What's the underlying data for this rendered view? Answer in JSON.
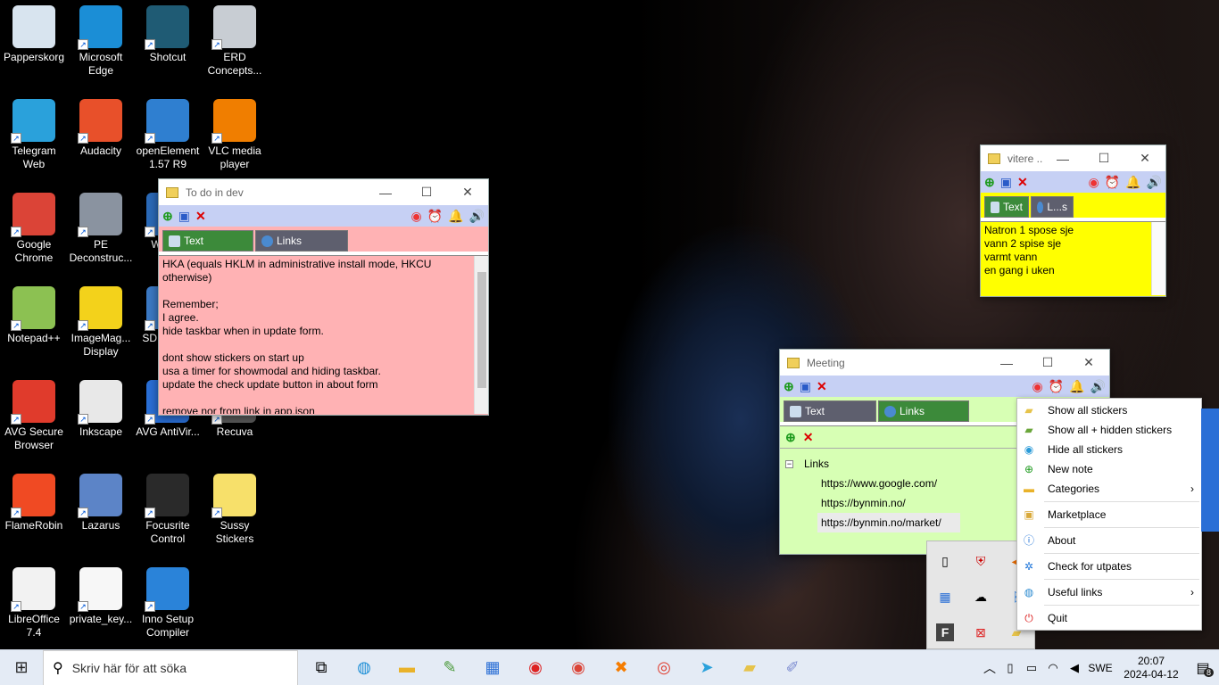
{
  "desktop_icons": [
    {
      "label": "Papperskorg",
      "icon": "recycle-bin-icon",
      "color": "#d8e4ef"
    },
    {
      "label": "Microsoft Edge",
      "icon": "edge-icon",
      "color": "#1b8ed6"
    },
    {
      "label": "Shotcut",
      "icon": "shotcut-icon",
      "color": "#1f5b74"
    },
    {
      "label": "ERD Concepts...",
      "icon": "erd-concepts-icon",
      "color": "#c8cdd3"
    },
    {
      "label": "Telegram Web",
      "icon": "telegram-icon",
      "color": "#2aa1db"
    },
    {
      "label": "Audacity",
      "icon": "audacity-icon",
      "color": "#e8502a"
    },
    {
      "label": "openElement 1.57 R9",
      "icon": "openelement-icon",
      "color": "#2f7fd0"
    },
    {
      "label": "VLC media player",
      "icon": "vlc-icon",
      "color": "#f07e00"
    },
    {
      "label": "Google Chrome",
      "icon": "chrome-icon",
      "color": "#db4437"
    },
    {
      "label": "PE Deconstruc...",
      "icon": "pe-deconstructor-icon",
      "color": "#8a93a0"
    },
    {
      "label": "Win3...",
      "icon": "win-icon",
      "color": "#2b6ab8"
    },
    {
      "label": "Notepad++",
      "icon": "notepad-plus-icon",
      "color": "#8cc152"
    },
    {
      "label": "ImageMag... Display",
      "icon": "imagemagick-icon",
      "color": "#f3d21b"
    },
    {
      "label": "SD... For...",
      "icon": "sd-icon",
      "color": "#3b79c4"
    },
    {
      "label": "AVG Secure Browser",
      "icon": "avg-browser-icon",
      "color": "#e03b2c"
    },
    {
      "label": "Inkscape",
      "icon": "inkscape-icon",
      "color": "#e8e8e8"
    },
    {
      "label": "AVG AntiVir...",
      "icon": "avg-antivirus-icon",
      "color": "#2a6fd6"
    },
    {
      "label": "Recuva",
      "icon": "recuva-icon",
      "color": "#5a5a5a"
    },
    {
      "label": "FlameRobin",
      "icon": "flamerobin-icon",
      "color": "#f04a23"
    },
    {
      "label": "Lazarus",
      "icon": "lazarus-icon",
      "color": "#5c84c7"
    },
    {
      "label": "Focusrite Control",
      "icon": "focusrite-icon",
      "color": "#2a2a2a"
    },
    {
      "label": "Sussy Stickers",
      "icon": "sussy-stickers-icon",
      "color": "#f7e06a"
    },
    {
      "label": "LibreOffice 7.4",
      "icon": "libreoffice-icon",
      "color": "#f2f2f2"
    },
    {
      "label": "private_key...",
      "icon": "file-icon",
      "color": "#f7f7f7"
    },
    {
      "label": "Inno Setup Compiler",
      "icon": "inno-setup-icon",
      "color": "#2a83d9"
    }
  ],
  "todo_window": {
    "title": "To do in dev",
    "tabs": [
      "Text",
      "Links"
    ],
    "bg": "#ffb2b4",
    "text": "HKA (equals HKLM in administrative install mode, HKCU otherwise)\n\nRemember;\nI agree.\nhide taskbar when in update form.\n\ndont show stickers on start up\nusa a timer for showmodal and hiding taskbar.\nupdate the check update button in about form\n\nremove nor from link in app.json"
  },
  "vitere_window": {
    "title": "vitere ...",
    "tabs": [
      "Text",
      "L...s"
    ],
    "bg": "#ffff00",
    "text": "Natron 1 spose sje\nvann 2 spise sje\nvarmt vann\nen gang i uken"
  },
  "meeting_window": {
    "title": "Meeting",
    "tabs": [
      "Text",
      "Links"
    ],
    "bg": "#d7ffb4",
    "tree_root": "Links",
    "links": [
      "https://www.google.com/",
      "https://bynmin.no/",
      "https://bynmin.no/market/"
    ]
  },
  "tray_menu": {
    "items": [
      {
        "label": "Show all stickers",
        "icon": "sticker-icon"
      },
      {
        "label": "Show all + hidden stickers",
        "icon": "sticker-plus-icon"
      },
      {
        "label": "Hide all stickers",
        "icon": "eye-icon"
      },
      {
        "label": "New note",
        "icon": "plus-icon"
      },
      {
        "label": "Categories",
        "icon": "folder-icon",
        "submenu": true
      },
      {
        "label": "Marketplace",
        "icon": "package-icon"
      },
      {
        "label": "About",
        "icon": "info-icon"
      },
      {
        "label": "Check for utpates",
        "icon": "gear-icon"
      },
      {
        "label": "Useful links",
        "icon": "globe-icon",
        "submenu": true
      },
      {
        "label": "Quit",
        "icon": "power-icon"
      }
    ]
  },
  "taskbar": {
    "search_placeholder": "Skriv här för att söka",
    "language": "SWE",
    "time": "20:07",
    "date": "2024-04-12",
    "notifications": "8"
  }
}
